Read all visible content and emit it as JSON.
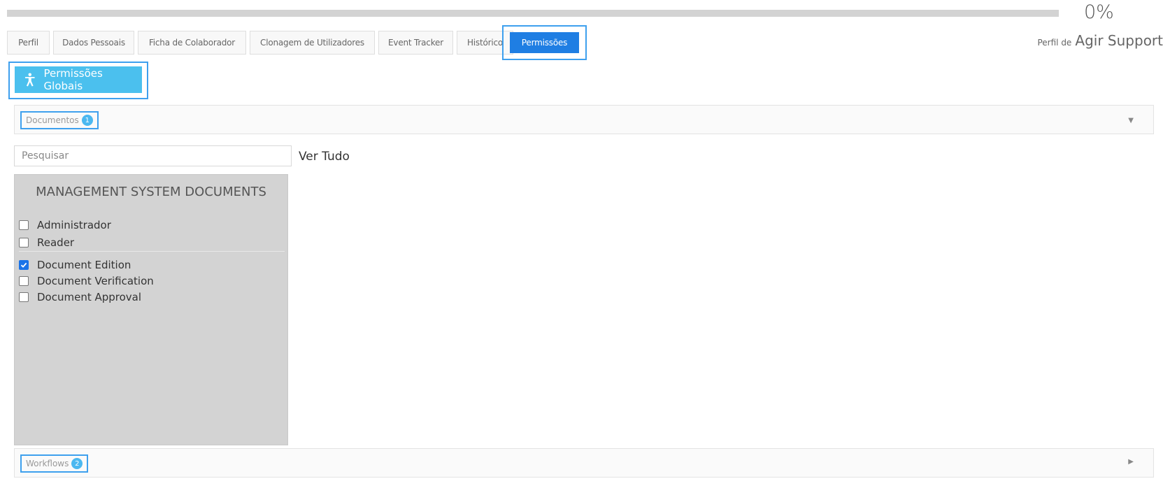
{
  "progress": {
    "value_percent": 0,
    "label": "0%"
  },
  "tabs": [
    {
      "label": "Perfil",
      "active": false
    },
    {
      "label": "Dados Pessoais",
      "active": false
    },
    {
      "label": "Ficha de Colaborador",
      "active": false
    },
    {
      "label": "Clonagem de Utilizadores",
      "active": false
    },
    {
      "label": "Event Tracker",
      "active": false
    },
    {
      "label": "Histórico",
      "active": false
    },
    {
      "label": "Permissões",
      "active": true
    }
  ],
  "profile": {
    "prefix": "Perfil de",
    "name": "Agir Support"
  },
  "global_button": {
    "label": "Permissões Globais",
    "icon": "accessibility-icon"
  },
  "documents_panel": {
    "label": "Documentos",
    "badge": "1",
    "caret": "caret-down-icon"
  },
  "search": {
    "placeholder": "Pesquisar",
    "value": ""
  },
  "see_all": "Ver Tudo",
  "card": {
    "title": "MANAGEMENT SYSTEM DOCUMENTS",
    "roles": [
      {
        "label": "Administrador",
        "checked": false
      },
      {
        "label": "Reader",
        "checked": false
      }
    ],
    "permissions": [
      {
        "label": "Document Edition",
        "checked": true
      },
      {
        "label": "Document Verification",
        "checked": false
      },
      {
        "label": "Document Approval",
        "checked": false
      }
    ]
  },
  "workflows_panel": {
    "label": "Workflows",
    "badge": "2",
    "caret": "caret-right-icon"
  },
  "colors": {
    "accent": "#1f7ee3",
    "highlight_border": "#3ea0ee",
    "button": "#4bc0ee",
    "card_bg": "#d3d3d3"
  }
}
